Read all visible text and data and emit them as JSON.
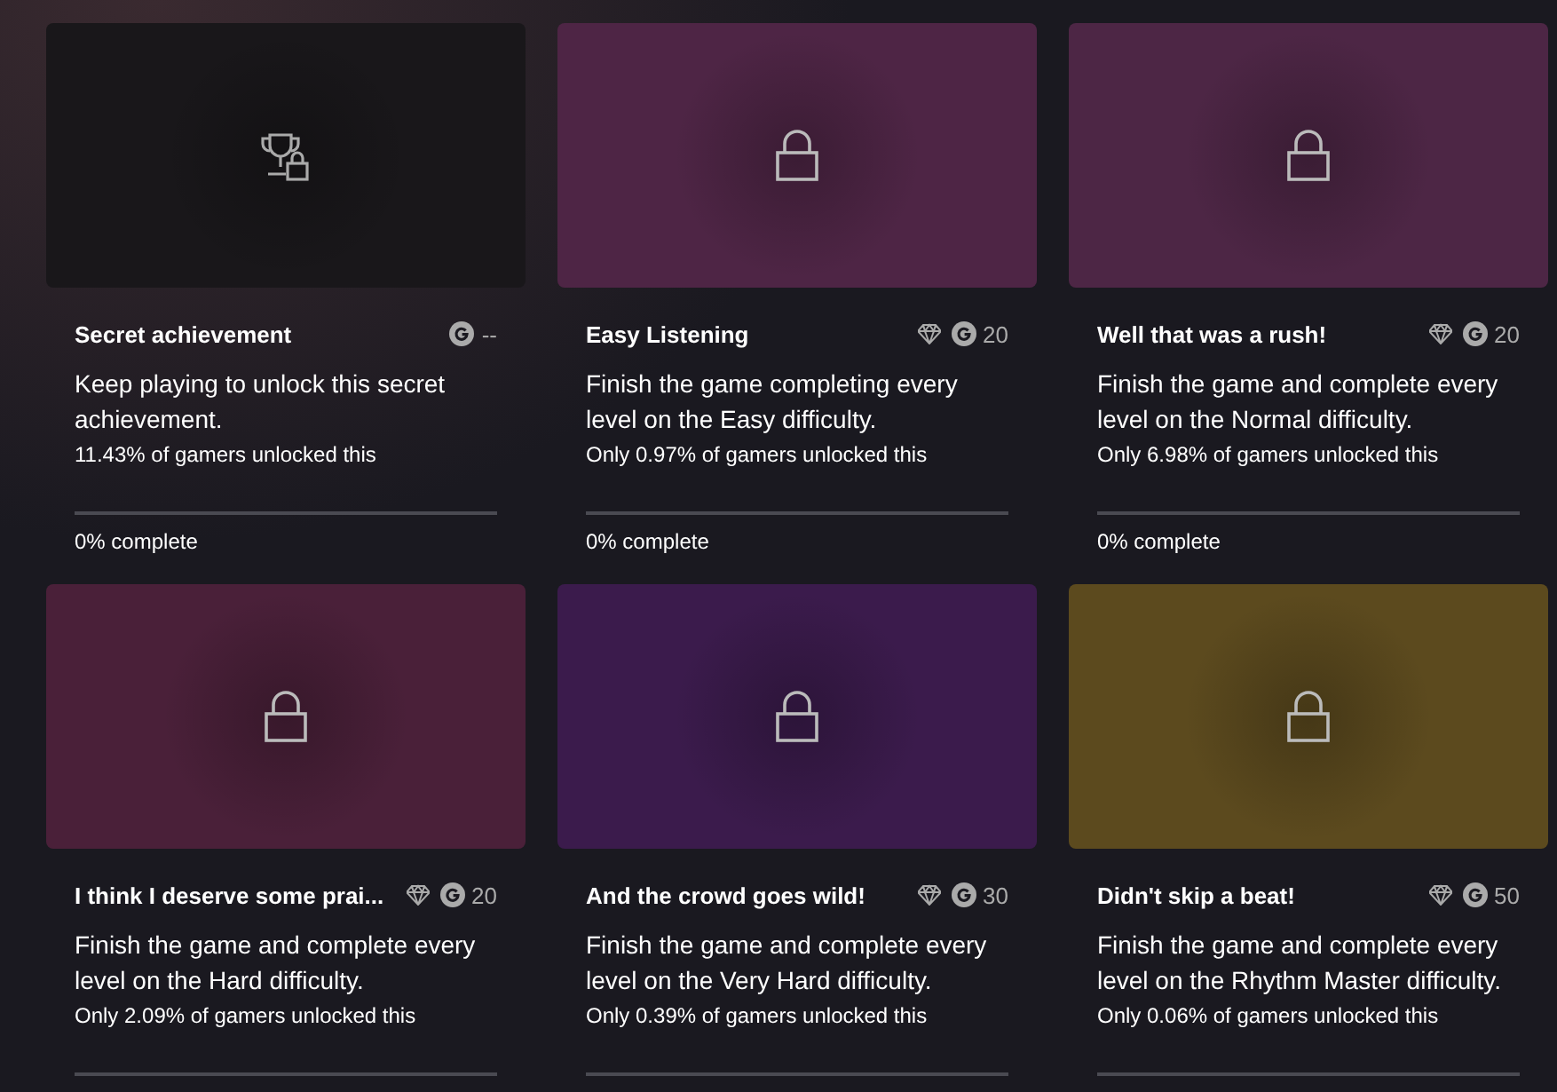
{
  "achievements": [
    {
      "tile": {
        "kind": "secret",
        "color": "#19171a"
      },
      "title": "Secret achievement",
      "rare": false,
      "points": "--",
      "description": "Keep playing to unlock this secret achievement.",
      "unlocked_by": "11.43% of gamers unlocked this",
      "progress": {
        "level": 0,
        "label": "0% complete"
      }
    },
    {
      "tile": {
        "kind": "locked",
        "color": "#4e2545"
      },
      "title": "Easy Listening",
      "rare": true,
      "points": "20",
      "description": "Finish the game completing every level on the Easy difficulty.",
      "unlocked_by": "Only 0.97% of gamers unlocked this",
      "progress": {
        "level": 0,
        "label": "0% complete"
      }
    },
    {
      "tile": {
        "kind": "locked",
        "color": "#4d2645"
      },
      "title": "Well that was a rush!",
      "rare": true,
      "points": "20",
      "description": "Finish the game and complete every level on the Normal difficulty.",
      "unlocked_by": "Only 6.98% of gamers unlocked this",
      "progress": {
        "level": 0,
        "label": "0% complete"
      }
    },
    {
      "tile": {
        "kind": "locked",
        "color": "#4a2039"
      },
      "title": "I think I deserve some prai...",
      "rare": true,
      "points": "20",
      "description": "Finish the game and complete every level on the Hard difficulty.",
      "unlocked_by": "Only 2.09% of gamers unlocked this",
      "progress": {
        "level": 0
      }
    },
    {
      "tile": {
        "kind": "locked",
        "color": "#3b1b4c"
      },
      "title": "And the crowd goes wild!",
      "rare": true,
      "points": "30",
      "description": "Finish the game and complete every level on the Very Hard difficulty.",
      "unlocked_by": "Only 0.39% of gamers unlocked this",
      "progress": {
        "level": 0
      }
    },
    {
      "tile": {
        "kind": "locked",
        "color": "#5c4a1e"
      },
      "title": "Didn't skip a beat!",
      "rare": true,
      "points": "50",
      "description": "Finish the game and complete every level on the Rhythm Master difficulty.",
      "unlocked_by": "Only 0.06% of gamers unlocked this",
      "progress": {
        "level": 0
      }
    }
  ]
}
